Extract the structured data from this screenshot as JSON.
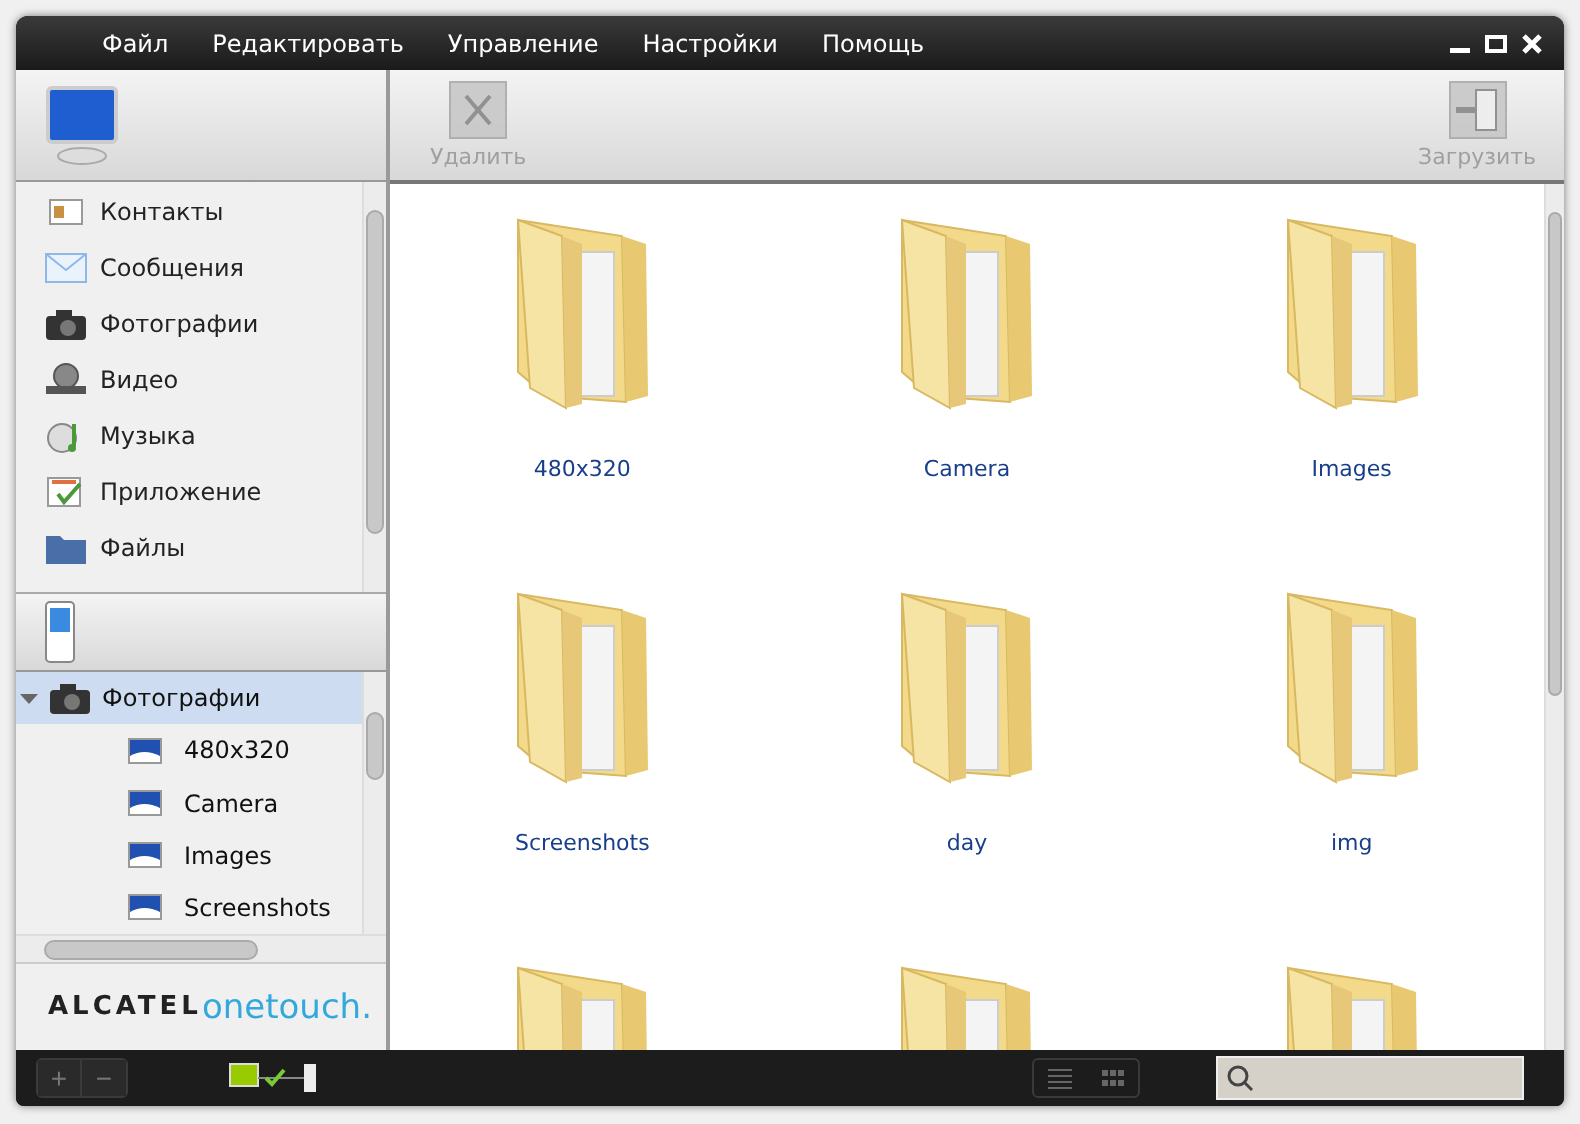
{
  "menu": [
    "Файл",
    "Редактировать",
    "Управление",
    "Настройки",
    "Помощь"
  ],
  "toolbar": [
    {
      "label": "Удалить",
      "kind": "delete",
      "disabled": true
    },
    {
      "label": "Загрузить",
      "kind": "upload",
      "disabled": true
    }
  ],
  "pc_nav": [
    {
      "label": "Контакты",
      "kind": "contacts"
    },
    {
      "label": "Сообщения",
      "kind": "messages"
    },
    {
      "label": "Фотографии",
      "kind": "photos"
    },
    {
      "label": "Видео",
      "kind": "video"
    },
    {
      "label": "Музыка",
      "kind": "music"
    },
    {
      "label": "Приложение",
      "kind": "apps"
    },
    {
      "label": "Файлы",
      "kind": "files"
    }
  ],
  "phone_tree": {
    "label": "Фотографии",
    "expanded": true,
    "selected": true,
    "children": [
      {
        "label": "480x320",
        "selected": false
      },
      {
        "label": "Camera",
        "selected": false
      },
      {
        "label": "Images",
        "selected": false
      },
      {
        "label": "Screenshots",
        "selected": false
      }
    ]
  },
  "brand": {
    "first": "ALCATEL",
    "second": "onetouch."
  },
  "folders": [
    {
      "kind": "folder",
      "name": "480x320"
    },
    {
      "kind": "folder",
      "name": "Camera"
    },
    {
      "kind": "folder",
      "name": "Images"
    },
    {
      "kind": "folder",
      "name": "Screenshots"
    },
    {
      "kind": "folder",
      "name": "day"
    },
    {
      "kind": "folder",
      "name": "img"
    },
    {
      "kind": "folder"
    },
    {
      "kind": "folder"
    },
    {
      "kind": "folder"
    }
  ],
  "bottom_buttons": [
    "+",
    "−"
  ]
}
